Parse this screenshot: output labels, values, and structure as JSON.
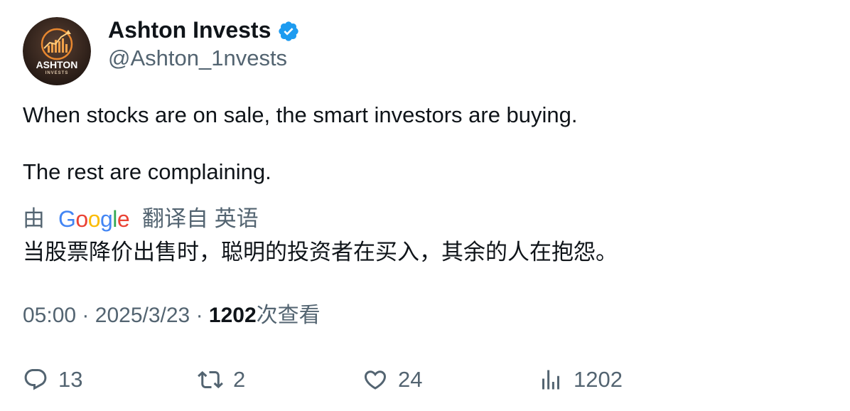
{
  "author": {
    "display_name": "Ashton Invests",
    "handle": "@Ashton_1nvests",
    "verified": true,
    "avatar": {
      "title": "ASHTON",
      "subtitle": "INVESTS",
      "icon": "rising-bar-chart-logo",
      "colors": {
        "background": "#3a2a22",
        "accent": "#e8872f"
      }
    }
  },
  "tweet": {
    "lines": [
      "When stocks are on sale, the smart investors are buying.",
      "The rest are complaining."
    ]
  },
  "translation": {
    "by_label": "由",
    "provider_logo": "Google",
    "from_label": "翻译自 英语",
    "text": "当股票降价出售时，聪明的投资者在买入，其余的人在抱怨。"
  },
  "meta": {
    "time": "05:00",
    "separator": "·",
    "date": "2025/3/23",
    "views_count": "1202",
    "views_label": "次查看"
  },
  "actions": {
    "replies": "13",
    "retweets": "2",
    "likes": "24",
    "views": "1202"
  },
  "colors": {
    "text_primary": "#0f1419",
    "text_secondary": "#536471",
    "verified_blue": "#1d9bf0"
  }
}
